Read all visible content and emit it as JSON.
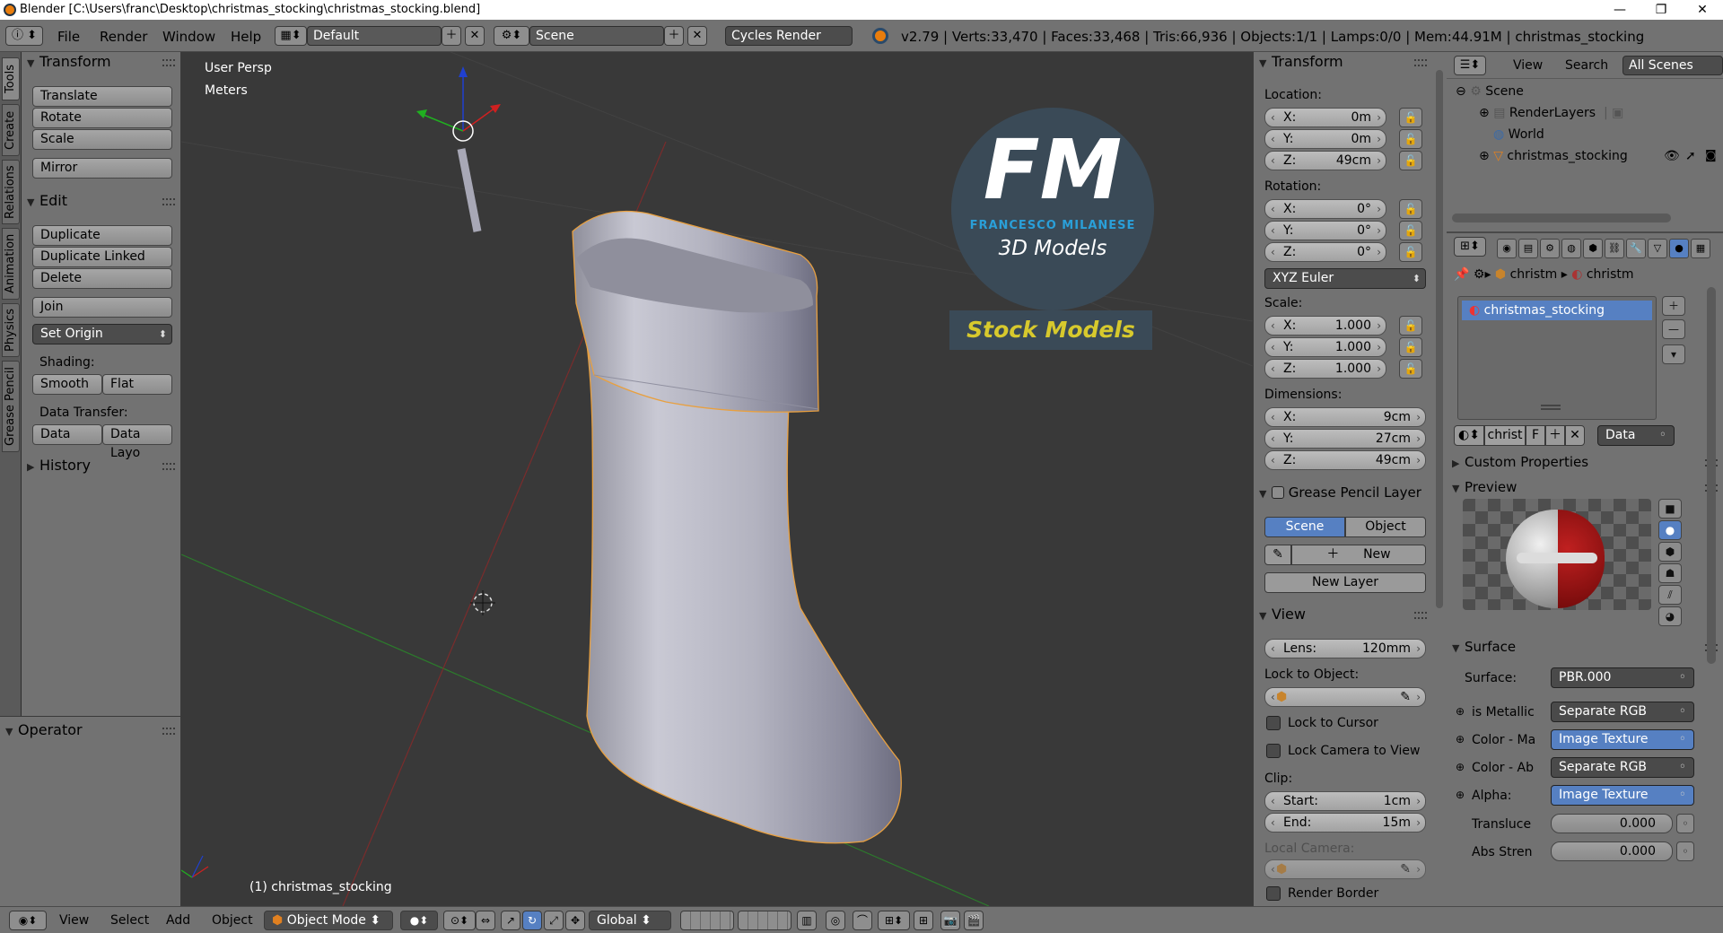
{
  "titlebar": {
    "title": "Blender [C:\\Users\\franc\\Desktop\\christmas_stocking\\christmas_stocking.blend]",
    "minimize": "—",
    "maximize": "❐",
    "close": "✕"
  },
  "infobar": {
    "menus": [
      "File",
      "Render",
      "Window",
      "Help"
    ],
    "screen_layout": "Default",
    "scene": "Scene",
    "render_engine": "Cycles Render",
    "stats": "v2.79 | Verts:33,470 | Faces:33,468 | Tris:66,936 | Objects:1/1 | Lamps:0/0 | Mem:44.91M | christmas_stocking"
  },
  "tool_tabs": [
    "Tools",
    "Create",
    "Relations",
    "Animation",
    "Physics",
    "Grease Pencil"
  ],
  "toolshelf": {
    "transform_title": "Transform",
    "translate": "Translate",
    "rotate": "Rotate",
    "scale": "Scale",
    "mirror": "Mirror",
    "edit_title": "Edit",
    "duplicate": "Duplicate",
    "duplicate_linked": "Duplicate Linked",
    "delete": "Delete",
    "join": "Join",
    "set_origin": "Set Origin",
    "shading_label": "Shading:",
    "smooth": "Smooth",
    "flat": "Flat",
    "data_transfer_label": "Data Transfer:",
    "data": "Data",
    "data_layout": "Data Layo",
    "history_title": "History",
    "operator_title": "Operator"
  },
  "viewport": {
    "view_name": "User Persp",
    "units": "Meters",
    "object_label": "(1) christmas_stocking",
    "logo_letters": "FM",
    "logo_name": "FRANCESCO MILANESE",
    "logo_sub": "3D Models",
    "logo_banner": "Stock Models"
  },
  "npanel": {
    "transform_title": "Transform",
    "location_label": "Location:",
    "loc_x": "0m",
    "loc_y": "0m",
    "loc_z": "49cm",
    "rotation_label": "Rotation:",
    "rot_x": "0°",
    "rot_y": "0°",
    "rot_z": "0°",
    "rotation_mode": "XYZ Euler",
    "scale_label": "Scale:",
    "scale_x": "1.000",
    "scale_y": "1.000",
    "scale_z": "1.000",
    "dimensions_label": "Dimensions:",
    "dim_x": "9cm",
    "dim_y": "27cm",
    "dim_z": "49cm",
    "axis_x": "X:",
    "axis_y": "Y:",
    "axis_z": "Z:",
    "gp_title": "Grease Pencil Layer",
    "gp_scene": "Scene",
    "gp_object": "Object",
    "gp_new": "New",
    "gp_new_layer": "New Layer",
    "view_title": "View",
    "lens_label": "Lens:",
    "lens_value": "120mm",
    "lock_to_object_label": "Lock to Object:",
    "lock_to_cursor": "Lock to Cursor",
    "lock_camera": "Lock Camera to View",
    "clip_label": "Clip:",
    "clip_start_label": "Start:",
    "clip_start": "1cm",
    "clip_end_label": "End:",
    "clip_end": "15m",
    "local_camera_label": "Local Camera:",
    "render_border": "Render Border"
  },
  "outliner": {
    "view_menu": "View",
    "search_menu": "Search",
    "display_mode": "All Scenes",
    "items": [
      "Scene",
      "RenderLayers",
      "World",
      "christmas_stocking"
    ]
  },
  "properties": {
    "breadcrumb_obj": "christm",
    "breadcrumb_mat": "christm",
    "material_slot": "christmas_stocking",
    "material_name": "christ",
    "fake_user": "F",
    "link_mode": "Data",
    "custom_properties": "Custom Properties",
    "preview_title": "Preview",
    "surface_title": "Surface",
    "surface_label": "Surface:",
    "surface_value": "PBR.000",
    "rows": [
      {
        "label": "is Metallic",
        "value": "Separate RGB",
        "blue": false
      },
      {
        "label": "Color - Ma",
        "value": "Image Texture",
        "blue": true
      },
      {
        "label": "Color - Ab",
        "value": "Separate RGB",
        "blue": false
      },
      {
        "label": "Alpha:",
        "value": "Image Texture",
        "blue": true
      }
    ],
    "translucent_label": "Transluce",
    "translucent_value": "0.000",
    "abs_label": "Abs Stren",
    "abs_value": "0.000"
  },
  "bottombar": {
    "menus": [
      "View",
      "Select",
      "Add",
      "Object"
    ],
    "mode": "Object Mode",
    "orientation": "Global"
  },
  "colors": {
    "accent": "#5680c2",
    "panel": "#727272",
    "viewport": "#393939",
    "logo_blue": "#2a9fd8",
    "logo_yellow": "#d7c92d"
  }
}
